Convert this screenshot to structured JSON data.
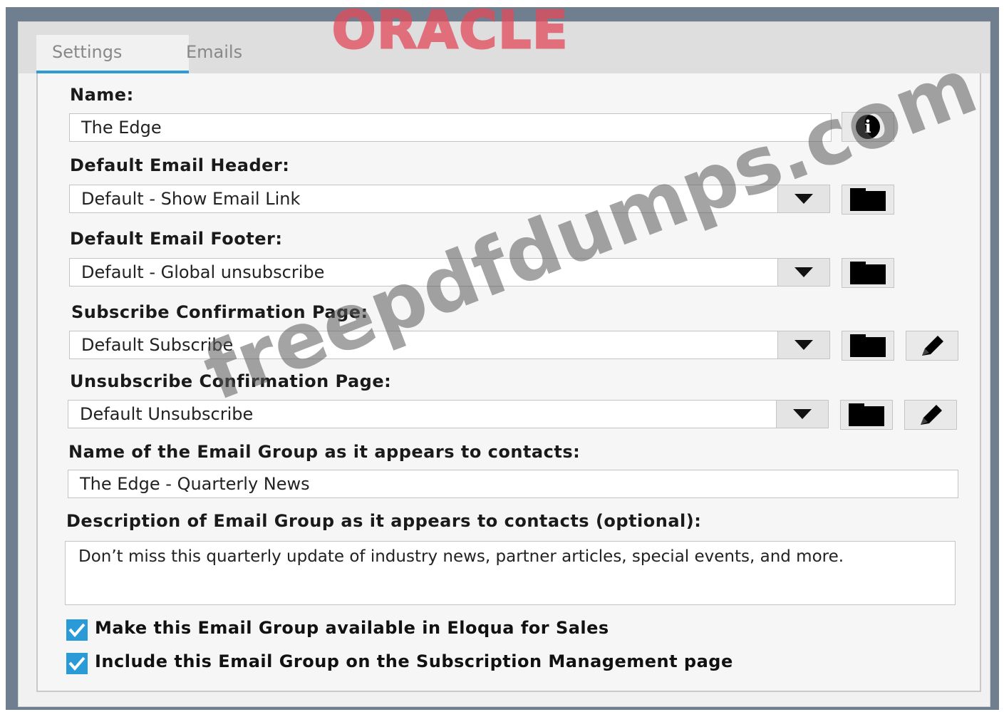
{
  "brand": {
    "logo_text": "ORACLE"
  },
  "tabs": [
    {
      "label": "Settings",
      "active": true
    },
    {
      "label": "Emails",
      "active": false
    }
  ],
  "form": {
    "name_label": "Name:",
    "name_value": "The Edge",
    "header_label": "Default Email Header:",
    "header_value": "Default - Show Email Link",
    "footer_label": "Default Email Footer:",
    "footer_value": "Default - Global unsubscribe",
    "subscribe_label": "Subscribe Confirmation Page:",
    "subscribe_value": "Default Subscribe",
    "unsubscribe_label": "Unsubscribe Confirmation Page:",
    "unsubscribe_value": "Default Unsubscribe",
    "group_name_label": "Name of the Email Group as it appears to contacts:",
    "group_name_value": "The Edge - Quarterly News",
    "description_label": "Description of Email Group as it appears to contacts (optional):",
    "description_value": "Don’t miss this quarterly update of industry news, partner articles, special events, and more."
  },
  "checkboxes": [
    {
      "label": "Make this Email Group available in Eloqua for Sales",
      "checked": true
    },
    {
      "label": "Include this Email Group on the Subscription Management page",
      "checked": true
    }
  ],
  "watermark": {
    "text": "freepdfdumps.com"
  },
  "colors": {
    "accent": "#2a9bd6",
    "frame": "#6f7f8f",
    "logo": "#e34a5a"
  },
  "icons": [
    "info-icon",
    "dropdown-arrow-icon",
    "folder-icon",
    "pencil-icon",
    "checkmark-icon"
  ]
}
